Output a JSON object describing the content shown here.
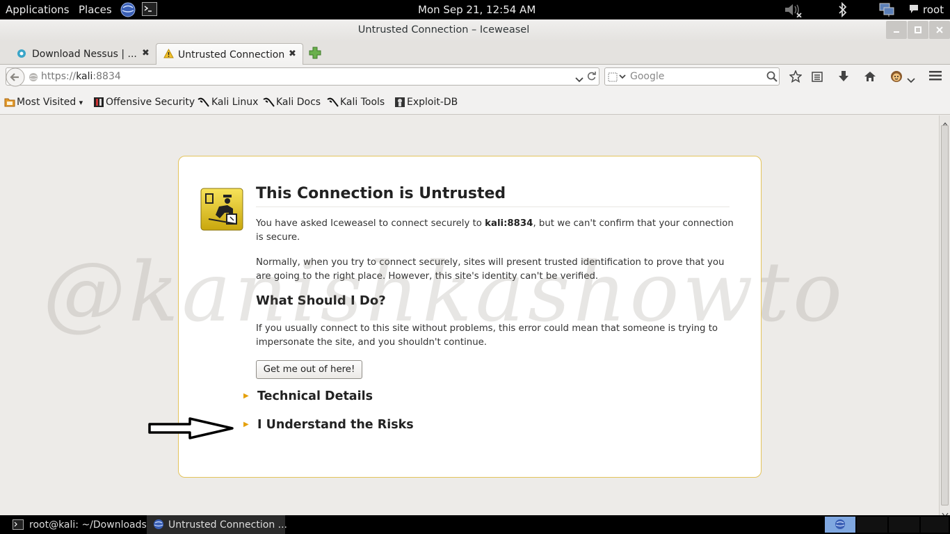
{
  "panel": {
    "applications": "Applications",
    "places": "Places",
    "clock": "Mon Sep 21, 12:54 AM",
    "user": "root",
    "icons": [
      "iceweasel-globe-icon",
      "terminal-icon",
      "volume-muted-icon",
      "bluetooth-icon",
      "network-icon",
      "chat-icon"
    ]
  },
  "window": {
    "title": "Untrusted Connection – Iceweasel"
  },
  "tabs": [
    {
      "label": "Download Nessus | ...",
      "icon": "nessus-icon"
    },
    {
      "label": "Untrusted Connection",
      "icon": "warning-icon"
    }
  ],
  "navbar": {
    "url_prefix": "https://",
    "url_host": "kali",
    "url_rest": ":8834",
    "search_placeholder": "Google"
  },
  "bookmarks": [
    {
      "label": "Most Visited",
      "icon": "folder-icon"
    },
    {
      "label": "Offensive Security",
      "icon": "offsec-icon"
    },
    {
      "label": "Kali Linux",
      "icon": "kali-dragon-icon"
    },
    {
      "label": "Kali Docs",
      "icon": "kali-dragon-icon"
    },
    {
      "label": "Kali Tools",
      "icon": "kali-dragon-icon"
    },
    {
      "label": "Exploit-DB",
      "icon": "exploitdb-icon"
    }
  ],
  "error": {
    "title": "This Connection is Untrusted",
    "p1_before": "You have asked Iceweasel to connect securely to ",
    "p1_host": "kali:8834",
    "p1_after": ", but we can't confirm that your connection is secure.",
    "p2": "Normally, when you try to connect securely, sites will present trusted identification to prove that you are going to the right place. However, this site's identity can't be verified.",
    "h2": "What Should I Do?",
    "p3": "If you usually connect to this site without problems, this error could mean that someone is trying to impersonate the site, and you shouldn't continue.",
    "button": "Get me out of here!",
    "technical": "Technical Details",
    "risks": "I Understand the Risks"
  },
  "watermark": "@kanishkashowto",
  "taskbar": [
    {
      "label": "root@kali: ~/Downloads",
      "icon": "terminal-icon"
    },
    {
      "label": "Untrusted Connection ...",
      "icon": "iceweasel-globe-icon"
    }
  ],
  "colors": {
    "accent_border": "#e3c35a",
    "expander_triangle": "#e5a10c",
    "panel_bg": "#000000"
  }
}
